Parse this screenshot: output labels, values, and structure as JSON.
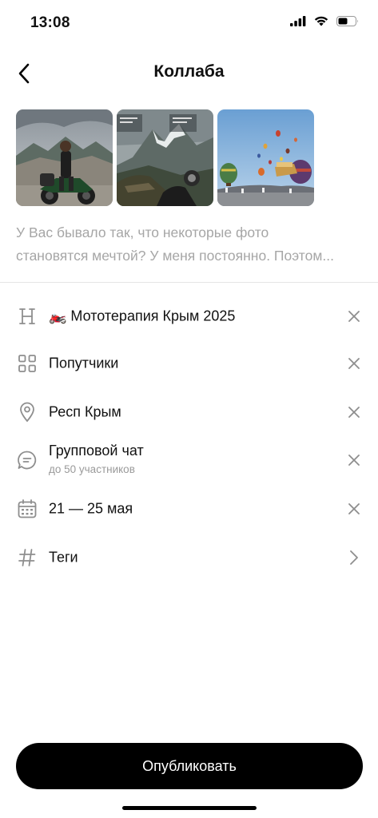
{
  "status_bar": {
    "time": "13:08",
    "icons": [
      "cellular-signal-icon",
      "wifi-icon",
      "battery-icon"
    ]
  },
  "nav": {
    "title": "Коллаба",
    "back_icon": "chevron-left-icon"
  },
  "photos": [
    {
      "name": "photo-biker-mountains"
    },
    {
      "name": "photo-motorcycle-mountain-view"
    },
    {
      "name": "photo-hot-air-balloons"
    }
  ],
  "description": {
    "line1": "У Вас бывало так, что некоторые фото",
    "line2": "становятся мечтой? У меня постоянно. Поэтом..."
  },
  "rows": {
    "title": {
      "icon": "heading-icon",
      "label": "🏍️ Мототерапия Крым 2025",
      "action": "close-icon"
    },
    "category": {
      "icon": "grid-icon",
      "label": "Попутчики",
      "action": "close-icon"
    },
    "location": {
      "icon": "location-pin-icon",
      "label": "Респ Крым",
      "action": "close-icon"
    },
    "chat": {
      "icon": "chat-bubble-icon",
      "label": "Групповой чат",
      "sublabel": "до 50 участников",
      "action": "close-icon"
    },
    "dates": {
      "icon": "calendar-icon",
      "label": "21 — 25 мая",
      "action": "close-icon"
    },
    "tags": {
      "icon": "hashtag-icon",
      "label": "Теги",
      "action": "chevron-right-icon"
    }
  },
  "publish_button": {
    "label": "Опубликовать"
  },
  "colors": {
    "primary": "#000000",
    "muted_text": "#a6a6a6",
    "icon_gray": "#8e8e8e"
  }
}
